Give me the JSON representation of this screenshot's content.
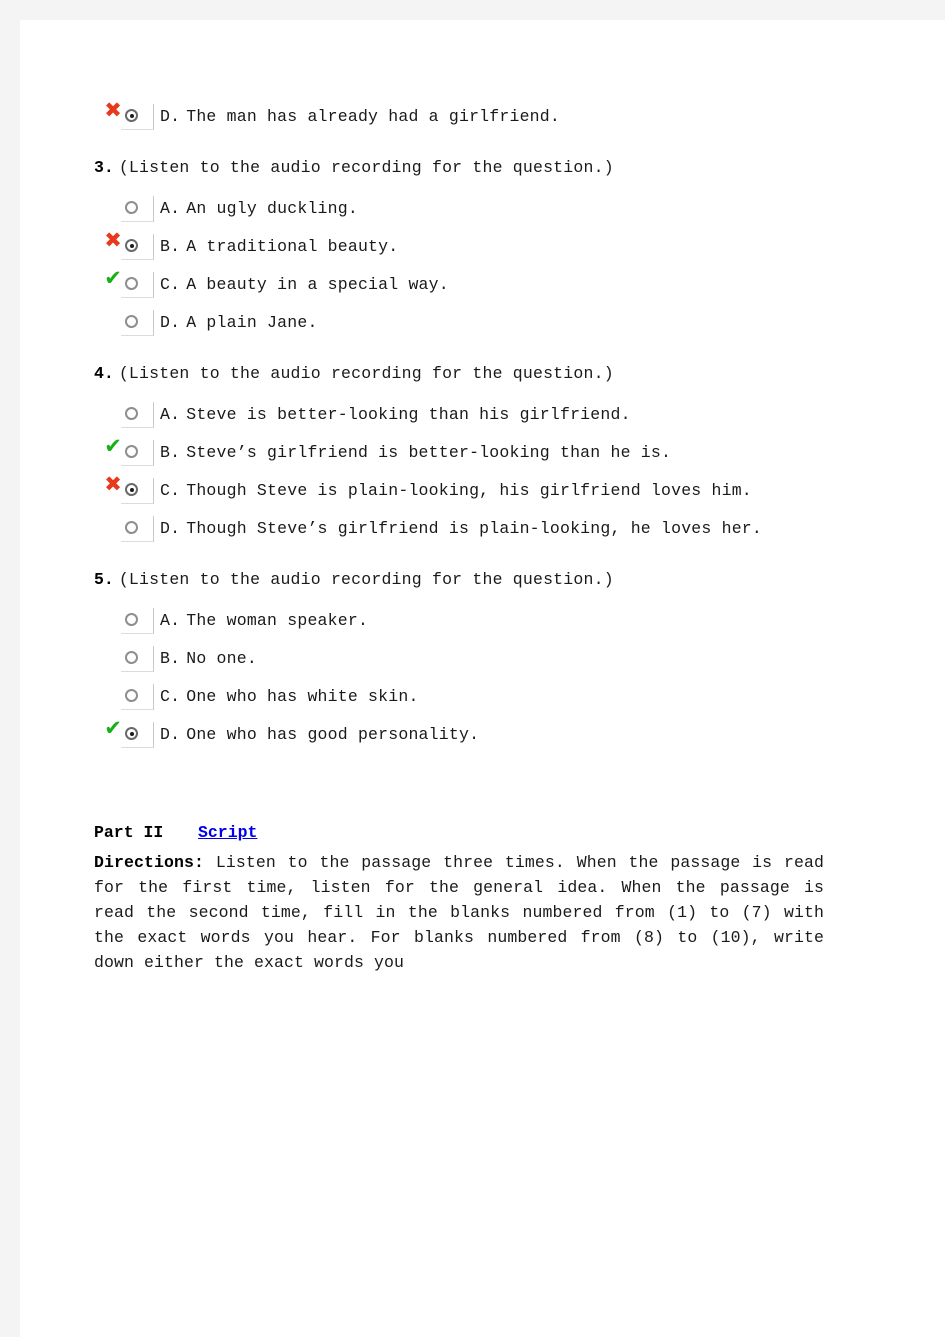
{
  "markers": {
    "wrong_glyph": "✖",
    "right_glyph": "✔",
    "wrong_color": "#e8391c",
    "right_color": "#17b017"
  },
  "orphan_option": {
    "letter": "D.",
    "text": "The man has already had a girlfriend.",
    "selected": true,
    "marker": "wrong"
  },
  "questions": [
    {
      "number": "3.",
      "prompt": "(Listen to the audio recording for the question.)",
      "options": [
        {
          "letter": "A.",
          "text": "An ugly duckling.",
          "selected": false,
          "marker": "none"
        },
        {
          "letter": "B.",
          "text": "A traditional beauty.",
          "selected": true,
          "marker": "wrong"
        },
        {
          "letter": "C.",
          "text": "A beauty in a special way.",
          "selected": false,
          "marker": "right"
        },
        {
          "letter": "D.",
          "text": "A plain Jane.",
          "selected": false,
          "marker": "none"
        }
      ]
    },
    {
      "number": "4.",
      "prompt": "(Listen to the audio recording for the question.)",
      "options": [
        {
          "letter": "A.",
          "text": "Steve is better-looking than his girlfriend.",
          "selected": false,
          "marker": "none"
        },
        {
          "letter": "B.",
          "text": "Steve’s girlfriend is better-looking than he is.",
          "selected": false,
          "marker": "right"
        },
        {
          "letter": "C.",
          "text": "Though Steve is plain-looking, his girlfriend loves him.",
          "selected": true,
          "marker": "wrong"
        },
        {
          "letter": "D.",
          "text": "Though Steve’s girlfriend is plain-looking, he loves her.",
          "selected": false,
          "marker": "none"
        }
      ]
    },
    {
      "number": "5.",
      "prompt": "(Listen to the audio recording for the question.)",
      "options": [
        {
          "letter": "A.",
          "text": "The woman speaker.",
          "selected": false,
          "marker": "none"
        },
        {
          "letter": "B.",
          "text": "No one.",
          "selected": false,
          "marker": "none"
        },
        {
          "letter": "C.",
          "text": "One who has white skin.",
          "selected": false,
          "marker": "none"
        },
        {
          "letter": "D.",
          "text": "One who has good personality.",
          "selected": true,
          "marker": "right"
        }
      ]
    }
  ],
  "part_two": {
    "part_label": "Part II",
    "script_link": "Script",
    "directions_label": "Directions:",
    "directions_text": " Listen to the passage three times. When the passage is read for the first time, listen for the general idea. When the passage is read the second time, fill in the blanks numbered from (1) to (7) with the exact words you hear. For blanks numbered from (8) to (10), write down either the exact words you"
  }
}
